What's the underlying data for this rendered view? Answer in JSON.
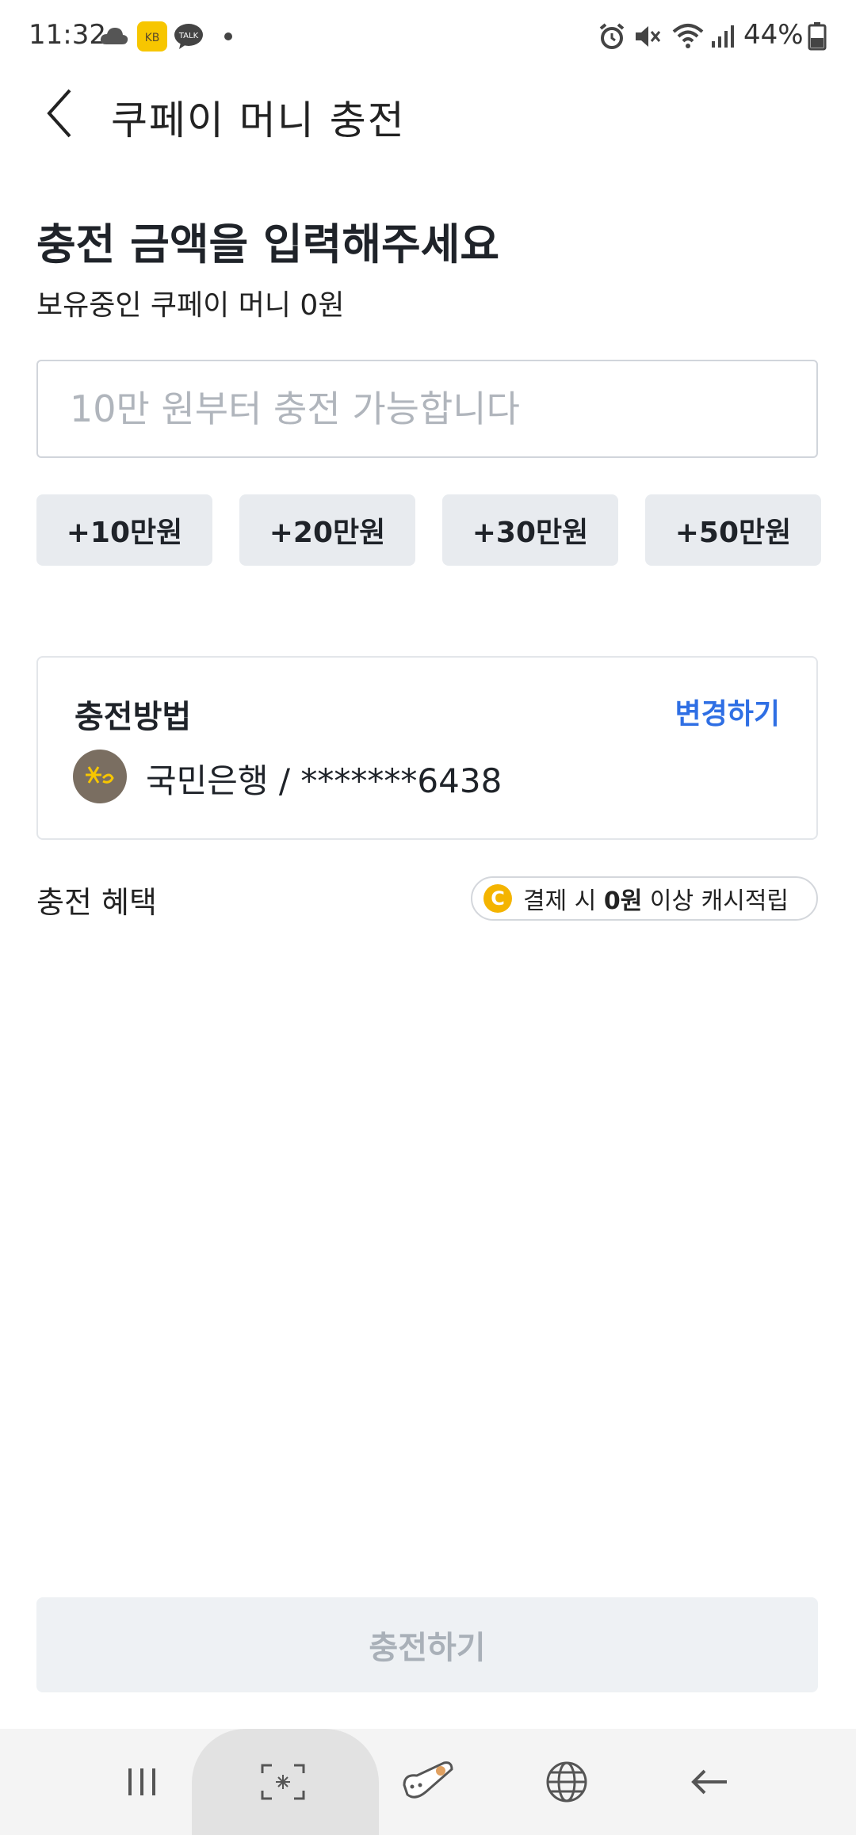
{
  "status_bar": {
    "time": "11:32",
    "battery_percent": "44%",
    "left_icons": [
      "cloud-icon",
      "kb-app-icon",
      "kakaotalk-icon",
      "dot-icon"
    ],
    "right_icons": [
      "alarm-icon",
      "mute-icon",
      "wifi-icon",
      "signal-icon",
      "battery-icon"
    ]
  },
  "header": {
    "title": "쿠페이 머니 충전"
  },
  "main": {
    "title": "충전 금액을 입력해주세요",
    "balance": "보유중인 쿠페이 머니 0원",
    "amount_input": {
      "value": "",
      "placeholder": "10만 원부터 충전 가능합니다"
    },
    "quick_amounts": [
      "+10만원",
      "+20만원",
      "+30만원",
      "+50만원"
    ]
  },
  "method": {
    "title": "충전방법",
    "change_label": "변경하기",
    "bank_account": "국민은행 / *******6438"
  },
  "benefit": {
    "label": "충전 혜택",
    "coin_letter": "C",
    "text_prefix": "결제 시 ",
    "text_bold": "0원",
    "text_suffix": " 이상 캐시적립"
  },
  "charge_button": "충전하기",
  "colors": {
    "accent_blue": "#2f6fe4",
    "coin_yellow": "#f4b400",
    "kb_brown": "#7a6e61",
    "chip_bg": "#e8ebef",
    "disabled_text": "#a9b0b8"
  }
}
